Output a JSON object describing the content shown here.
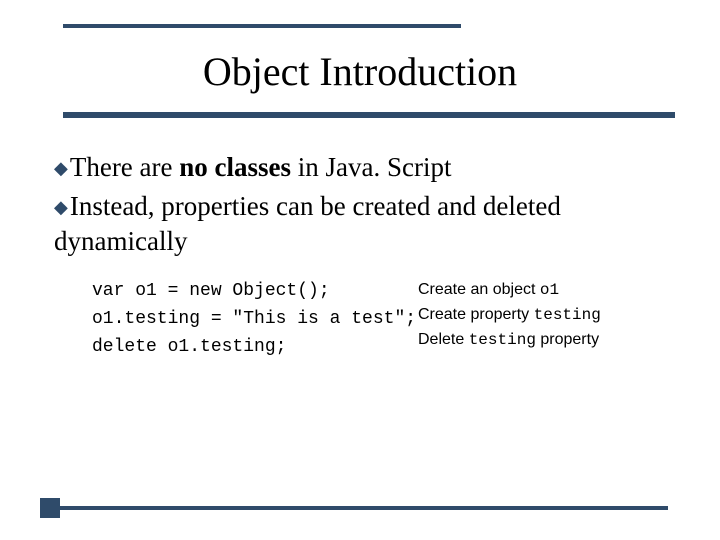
{
  "title": "Object Introduction",
  "bullets": [
    {
      "pre": "There are ",
      "bold": "no classes",
      "post": " in Java. Script"
    },
    {
      "pre": "Instead, properties can be created and deleted dynamically",
      "bold": "",
      "post": ""
    }
  ],
  "code": {
    "l1": "var o1 = new Object();",
    "l2": "o1.testing = \"This is a test\";",
    "l3": "delete o1.testing;"
  },
  "annot": {
    "l1a": "Create an object ",
    "l1b": "o1",
    "l2a": "Create property ",
    "l2b": "testing",
    "l3a": "Delete ",
    "l3b": "testing",
    "l3c": " property"
  }
}
